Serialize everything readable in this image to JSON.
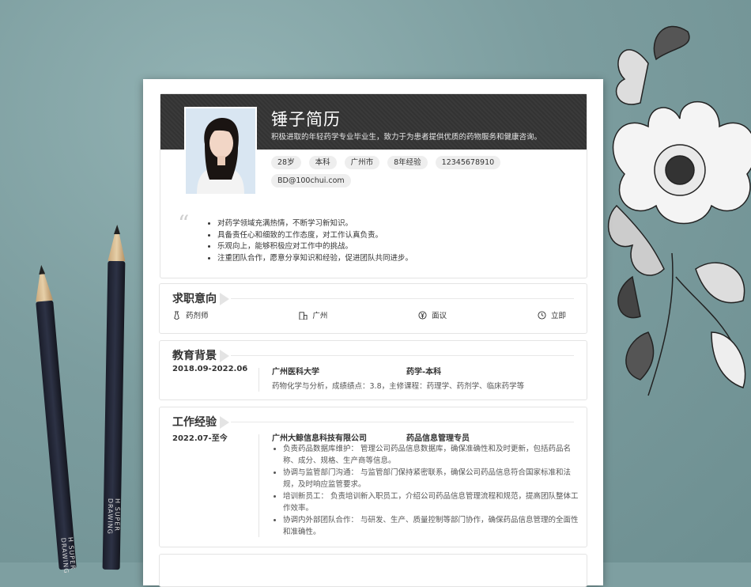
{
  "resume": {
    "name": "锤子简历",
    "tagline": "积极进取的年轻药学专业毕业生，致力于为患者提供优质的药物服务和健康咨询。",
    "tags": [
      "28岁",
      "本科",
      "广州市",
      "8年经验",
      "12345678910",
      "BD@100chui.com"
    ],
    "intro": [
      "对药学领域充满热情，不断学习新知识。",
      "具备责任心和细致的工作态度，对工作认真负责。",
      "乐观向上，能够积极应对工作中的挑战。",
      "注重团队合作，愿意分享知识和经验，促进团队共同进步。"
    ]
  },
  "intent": {
    "title": "求职意向",
    "position": "药剂师",
    "city": "广州",
    "salary": "面议",
    "availability": "立即"
  },
  "education": {
    "title": "教育背景",
    "date": "2018.09-2022.06",
    "school": "广州医科大学",
    "degree": "药学-本科",
    "desc": "药物化学与分析，成绩绩点：3.8，主修课程：药理学、药剂学、临床药学等"
  },
  "work": {
    "title": "工作经验",
    "date": "2022.07-至今",
    "company": "广州大鲸信息科技有限公司",
    "role": "药品信息管理专员",
    "duties": [
      "负责药品数据库维护： 管理公司药品信息数据库，确保准确性和及时更新，包括药品名称、成分、规格、生产商等信息。",
      "协调与监管部门沟通： 与监管部门保持紧密联系，确保公司药品信息符合国家标准和法规，及时响应监管要求。",
      "培训新员工： 负责培训新入职员工，介绍公司药品信息管理流程和规范，提高团队整体工作效率。",
      "协调内外部团队合作： 与研发、生产、质量控制等部门协作，确保药品信息管理的全面性和准确性。"
    ]
  },
  "pencil_brand": "H  SUPER DRAWING"
}
